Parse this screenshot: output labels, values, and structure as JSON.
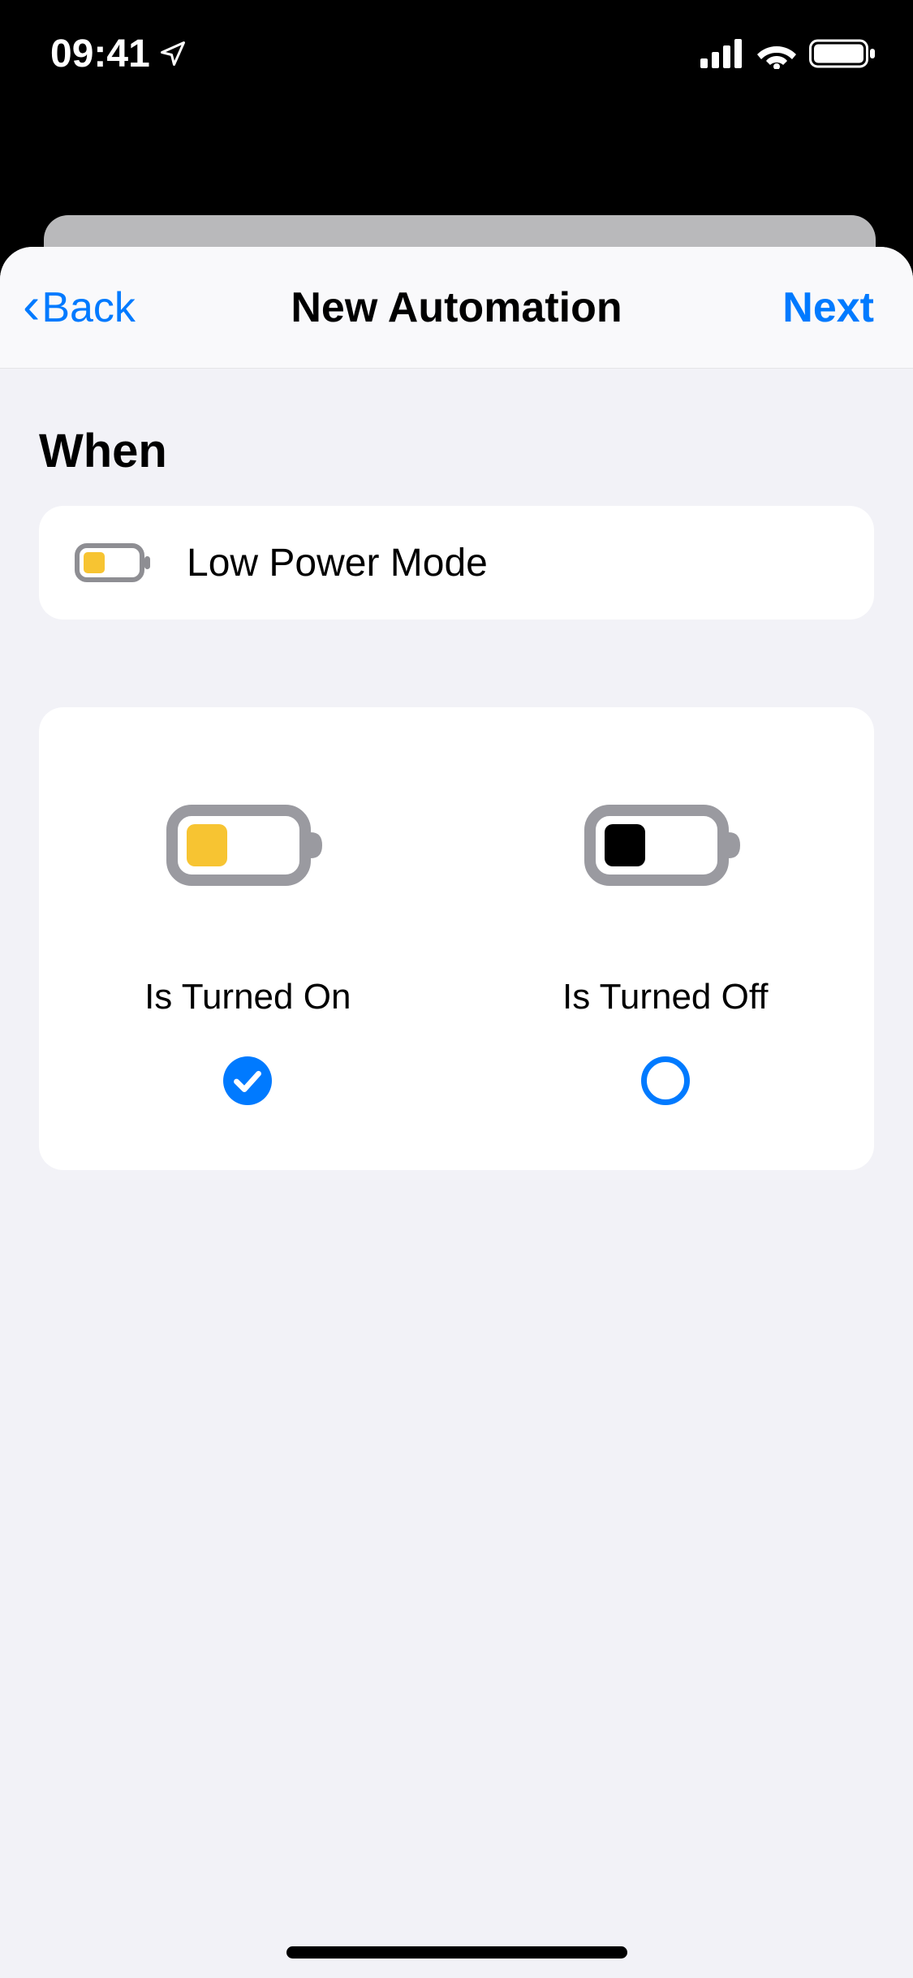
{
  "status": {
    "time": "09:41"
  },
  "nav": {
    "back": "Back",
    "title": "New Automation",
    "next": "Next"
  },
  "section": {
    "when": "When"
  },
  "trigger": {
    "label": "Low Power Mode"
  },
  "options": {
    "on": {
      "label": "Is Turned On",
      "selected": true
    },
    "off": {
      "label": "Is Turned Off",
      "selected": false
    }
  },
  "colors": {
    "accent": "#007aff",
    "lpmYellow": "#f7c432"
  }
}
